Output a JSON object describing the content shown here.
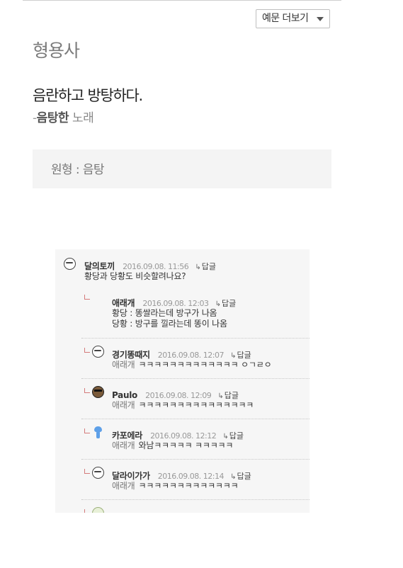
{
  "example_more_button": {
    "label": "예문 더보기"
  },
  "entry": {
    "part_of_speech": "형용사",
    "definition": "음란하고 방탕하다.",
    "example": {
      "dash": "-",
      "word": "음탕한",
      "rest": " 노래"
    },
    "origin": "원형 : 음탕"
  },
  "comments": {
    "reply_label": "답글",
    "items": [
      {
        "nick": "달의토끼",
        "date": "2016.09.08. 11:56",
        "mention": "",
        "text": "황당과 당황도 비슷할려나요?",
        "icon": "face-icon"
      },
      {
        "nick": "애래개",
        "date": "2016.09.08. 12:03",
        "mention": "",
        "text": "황당 : 똥쌀라는데 방구가 나옴",
        "text2": "당황 : 방구를 낄라는데 똥이 나옴",
        "icon": ""
      },
      {
        "nick": "경기똥때지",
        "date": "2016.09.08. 12:07",
        "mention": "애래개",
        "text": "ㅋㅋㅋㅋㅋㅋㅋㅋㅋㅋㅋㅋㅋ ㅇㄱㄹㅇ",
        "icon": "face-icon"
      },
      {
        "nick": "Paulo",
        "date": "2016.09.08. 12:09",
        "mention": "애래개",
        "text": "ㅋㅋㅋㅋㅋㅋㅋㅋㅋㅋㅋㅋㅋㅋㅋ",
        "icon": "sunglasses-face-icon"
      },
      {
        "nick": "카포에라",
        "date": "2016.09.08. 12:12",
        "mention": "애래개",
        "text": "와남ㅋㅋㅋㅋㅋ ㅋㅋㅋㅋㅋ",
        "icon": "blue-character-icon"
      },
      {
        "nick": "달라이가가",
        "date": "2016.09.08. 12:14",
        "mention": "애래개",
        "text": "ㅋㅋㅋㅋㅋㅋㅋㅋㅋㅋㅋㅋㅋ",
        "icon": "face-icon"
      }
    ]
  }
}
